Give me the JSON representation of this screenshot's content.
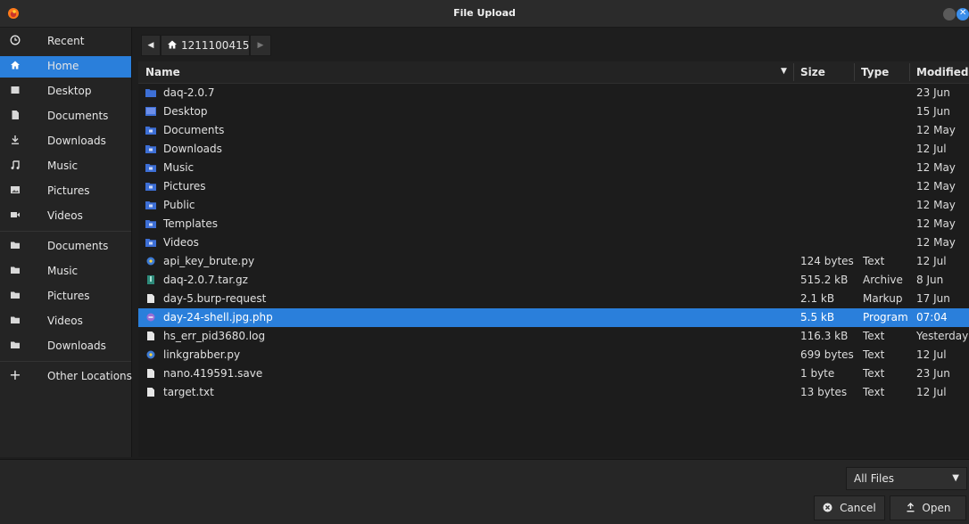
{
  "window": {
    "title": "File Upload",
    "app_icon": "firefox-icon"
  },
  "sidebar": {
    "items": [
      {
        "label": "Recent",
        "icon": "clock-icon"
      },
      {
        "label": "Home",
        "icon": "home-icon",
        "active": true
      },
      {
        "label": "Desktop",
        "icon": "desktop-icon"
      },
      {
        "label": "Documents",
        "icon": "document-icon"
      },
      {
        "label": "Downloads",
        "icon": "download-icon"
      },
      {
        "label": "Music",
        "icon": "music-icon"
      },
      {
        "label": "Pictures",
        "icon": "picture-icon"
      },
      {
        "label": "Videos",
        "icon": "video-icon"
      },
      {
        "label": "Documents",
        "icon": "folder-icon"
      },
      {
        "label": "Music",
        "icon": "folder-icon"
      },
      {
        "label": "Pictures",
        "icon": "folder-icon"
      },
      {
        "label": "Videos",
        "icon": "folder-icon"
      },
      {
        "label": "Downloads",
        "icon": "folder-icon"
      },
      {
        "label": "Other Locations",
        "icon": "plus-icon"
      }
    ]
  },
  "pathbar": {
    "current": "1211100415"
  },
  "columns": {
    "name": "Name",
    "size": "Size",
    "type": "Type",
    "modified": "Modified"
  },
  "files": [
    {
      "name": "daq-2.0.7",
      "size": "",
      "type": "",
      "modified": "23 Jun",
      "icon": "folder"
    },
    {
      "name": "Desktop",
      "size": "",
      "type": "",
      "modified": "15 Jun",
      "icon": "folder-desktop"
    },
    {
      "name": "Documents",
      "size": "",
      "type": "",
      "modified": "12 May",
      "icon": "folder"
    },
    {
      "name": "Downloads",
      "size": "",
      "type": "",
      "modified": "12 Jul",
      "icon": "folder"
    },
    {
      "name": "Music",
      "size": "",
      "type": "",
      "modified": "12 May",
      "icon": "folder"
    },
    {
      "name": "Pictures",
      "size": "",
      "type": "",
      "modified": "12 May",
      "icon": "folder"
    },
    {
      "name": "Public",
      "size": "",
      "type": "",
      "modified": "12 May",
      "icon": "folder"
    },
    {
      "name": "Templates",
      "size": "",
      "type": "",
      "modified": "12 May",
      "icon": "folder"
    },
    {
      "name": "Videos",
      "size": "",
      "type": "",
      "modified": "12 May",
      "icon": "folder"
    },
    {
      "name": "api_key_brute.py",
      "size": "124 bytes",
      "type": "Text",
      "modified": "12 Jul",
      "icon": "python"
    },
    {
      "name": "daq-2.0.7.tar.gz",
      "size": "515.2 kB",
      "type": "Archive",
      "modified": "8 Jun",
      "icon": "archive"
    },
    {
      "name": "day-5.burp-request",
      "size": "2.1 kB",
      "type": "Markup",
      "modified": "17 Jun",
      "icon": "file"
    },
    {
      "name": "day-24-shell.jpg.php",
      "size": "5.5 kB",
      "type": "Program",
      "modified": "07:04",
      "icon": "php",
      "selected": true
    },
    {
      "name": "hs_err_pid3680.log",
      "size": "116.3 kB",
      "type": "Text",
      "modified": "Yesterday",
      "icon": "file"
    },
    {
      "name": "linkgrabber.py",
      "size": "699 bytes",
      "type": "Text",
      "modified": "12 Jul",
      "icon": "python"
    },
    {
      "name": "nano.419591.save",
      "size": "1 byte",
      "type": "Text",
      "modified": "23 Jun",
      "icon": "file"
    },
    {
      "name": "target.txt",
      "size": "13 bytes",
      "type": "Text",
      "modified": "12 Jul",
      "icon": "file"
    }
  ],
  "filter": {
    "selected": "All Files"
  },
  "buttons": {
    "cancel": "Cancel",
    "open": "Open"
  },
  "colors": {
    "accent": "#2a7fdb",
    "folder": "#3d6fd6",
    "background": "#1e1e1e"
  }
}
